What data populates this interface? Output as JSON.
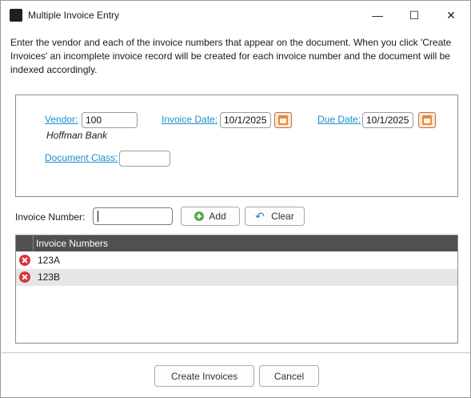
{
  "window": {
    "title": "Multiple Invoice Entry"
  },
  "titlebar": {
    "minimize": "—",
    "maximize": "☐",
    "close": "✕"
  },
  "intro_text": "Enter the vendor and each of the invoice numbers that appear on the document. When you click 'Create Invoices' an incomplete invoice record will be created for each invoice number and the document will be indexed accordingly.",
  "form": {
    "vendor_label": "Vendor:",
    "vendor_value": "100",
    "vendor_name": "Hoffman Bank",
    "invoice_date_label": "Invoice Date:",
    "invoice_date_value": "10/1/2025",
    "due_date_label": "Due Date:",
    "due_date_value": "10/1/2025",
    "document_class_label": "Document Class:",
    "document_class_value": ""
  },
  "entry": {
    "invoice_number_label": "Invoice Number:",
    "invoice_number_value": "",
    "add_label": "Add",
    "clear_label": "Clear"
  },
  "grid": {
    "header": "Invoice Numbers",
    "rows": [
      "123A",
      "123B"
    ]
  },
  "footer": {
    "create_label": "Create Invoices",
    "cancel_label": "Cancel"
  }
}
